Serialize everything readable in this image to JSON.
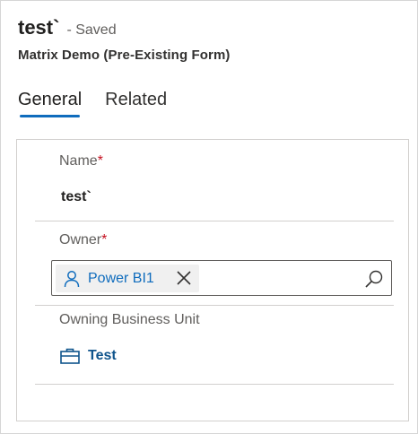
{
  "header": {
    "record_title": "test`",
    "save_status": "- Saved",
    "form_name": "Matrix Demo (Pre-Existing Form)"
  },
  "tabs": [
    {
      "label": "General",
      "active": true
    },
    {
      "label": "Related",
      "active": false
    }
  ],
  "fields": {
    "name": {
      "label": "Name",
      "required_marker": "*",
      "value": "test`"
    },
    "owner": {
      "label": "Owner",
      "required_marker": "*",
      "value": "Power BI1",
      "icon": "person-icon"
    },
    "owning_business_unit": {
      "label": "Owning Business Unit",
      "value": "Test",
      "icon": "briefcase-icon"
    }
  },
  "colors": {
    "accent": "#0f6cbd",
    "link": "#0f548c",
    "required": "#c50f1f",
    "tag_background": "#f0f0f0"
  }
}
